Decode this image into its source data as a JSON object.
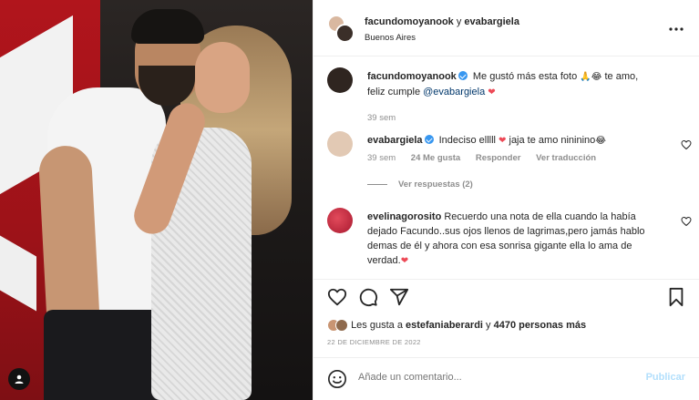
{
  "header": {
    "user1": "facundomoyanook",
    "connector": "y",
    "user2": "evabargiela",
    "location": "Buenos Aires"
  },
  "comments": [
    {
      "user": "facundomoyanook",
      "verified": true,
      "text_before": "Me gustó más esta foto",
      "emoji1": "🙏😂",
      "text_after": "te amo,",
      "line2": "feliz cumple",
      "mention": "@evabargiela",
      "heart": "❤",
      "time": "39 sem"
    },
    {
      "user": "evabargiela",
      "verified": true,
      "text_before": "Indeciso elllll",
      "heart": "❤",
      "text_after": "jaja te amo nininino",
      "emoji_end": "😂",
      "time": "39 sem",
      "likes": "24 Me gusta",
      "reply": "Responder",
      "translate": "Ver traducción",
      "view_replies": "Ver respuestas (2)"
    },
    {
      "user": "evelinagorosito",
      "text": "Recuerdo una nota de ella cuando la había dejado Facundo..sus ojos llenos de lagrimas,pero jamás hablo demas de él y ahora con esa sonrisa gigante ella lo ama de verdad.",
      "heart": "❤"
    }
  ],
  "likes": {
    "prefix": "Les gusta a",
    "user": "estefaniaberardi",
    "connector": "y",
    "count": "4470 personas más"
  },
  "date": "22 DE DICIEMBRE DE 2022",
  "add_comment": {
    "placeholder": "Añade un comentario...",
    "post_label": "Publicar"
  },
  "icons": {
    "more": "more-horizontal-icon",
    "like": "heart-icon",
    "comment": "comment-icon",
    "share": "send-icon",
    "save": "bookmark-icon",
    "emoji": "emoji-icon"
  },
  "colors": {
    "verified": "#3897f0",
    "heart": "#ed4956",
    "mention": "#00376b",
    "muted": "#8e8e8e",
    "post_disabled": "#b2dffc"
  }
}
